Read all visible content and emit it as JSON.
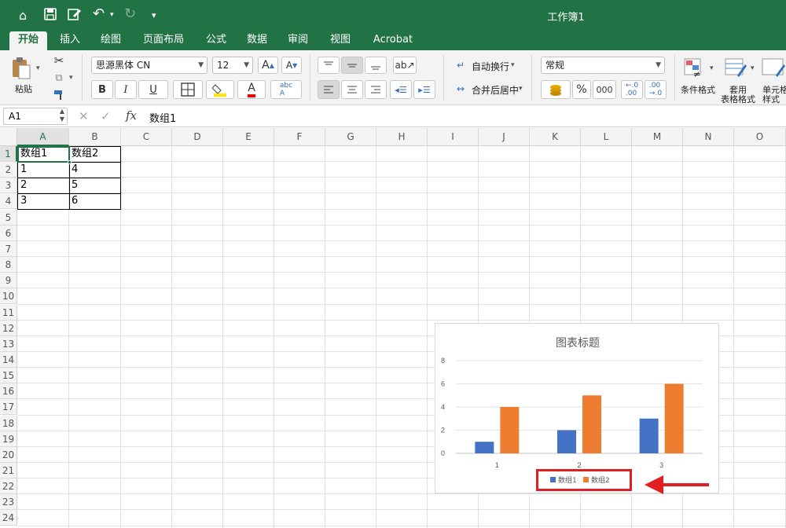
{
  "window": {
    "title": "工作簿1"
  },
  "tabs": [
    "开始",
    "插入",
    "绘图",
    "页面布局",
    "公式",
    "数据",
    "审阅",
    "视图",
    "Acrobat"
  ],
  "active_tab": "开始",
  "ribbon": {
    "paste_label": "粘贴",
    "font_name": "思源黑体 CN",
    "font_size": "12",
    "bold": "B",
    "italic": "I",
    "underline": "U",
    "wrap_text": "自动换行",
    "merge_center": "合并后居中",
    "number_format": "常规",
    "percent": "%",
    "comma": "000",
    "cond_format": "条件格式",
    "table_format_line1": "套用",
    "table_format_line2": "表格格式",
    "cell_style_line1": "单元格",
    "cell_style_line2": "样式"
  },
  "formula_bar": {
    "name_box": "A1",
    "fx": "fx",
    "content": "数组1"
  },
  "grid": {
    "columns": [
      "A",
      "B",
      "C",
      "D",
      "E",
      "F",
      "G",
      "H",
      "I",
      "J",
      "K",
      "L",
      "M",
      "N",
      "O"
    ],
    "rows": [
      "1",
      "2",
      "3",
      "4",
      "5",
      "6",
      "7",
      "8",
      "9",
      "10",
      "11",
      "12",
      "13",
      "14",
      "15",
      "16",
      "17",
      "18",
      "19",
      "20",
      "21",
      "22",
      "23",
      "24"
    ],
    "cells": [
      [
        "数组1",
        "数组2"
      ],
      [
        "1",
        "4"
      ],
      [
        "2",
        "5"
      ],
      [
        "3",
        "6"
      ]
    ],
    "selected_cell": "A1"
  },
  "chart_data": {
    "type": "bar",
    "title": "图表标题",
    "categories": [
      "1",
      "2",
      "3"
    ],
    "series": [
      {
        "name": "数组1",
        "values": [
          1,
          2,
          3
        ],
        "color": "#4472c4"
      },
      {
        "name": "数组2",
        "values": [
          4,
          5,
          6
        ],
        "color": "#ed7d31"
      }
    ],
    "yticks": [
      "0",
      "2",
      "4",
      "6",
      "8"
    ],
    "ylim": [
      0,
      8
    ],
    "grid": true,
    "legend_position": "bottom",
    "annotation_color": "#e02020"
  }
}
